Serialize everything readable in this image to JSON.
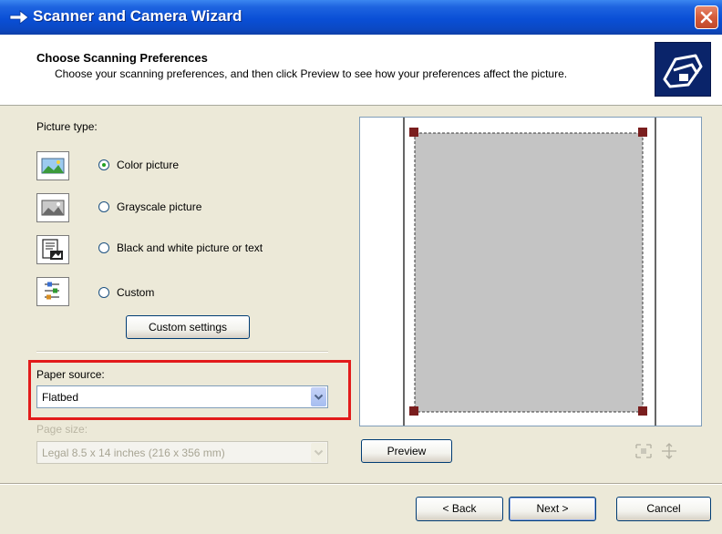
{
  "window": {
    "title": "Scanner and Camera Wizard",
    "close_icon": "close-icon"
  },
  "header": {
    "title": "Choose Scanning Preferences",
    "description": "Choose your scanning preferences, and then click Preview to see how your preferences affect the picture.",
    "icon": "scanner-wizard-icon"
  },
  "picture_type": {
    "label": "Picture type:",
    "options": [
      {
        "label": "Color picture",
        "icon": "color-picture-icon",
        "selected": true
      },
      {
        "label": "Grayscale picture",
        "icon": "grayscale-picture-icon",
        "selected": false
      },
      {
        "label": "Black and white picture or text",
        "icon": "black-white-text-icon",
        "selected": false
      },
      {
        "label": "Custom",
        "icon": "custom-icon",
        "selected": false
      }
    ],
    "custom_settings_label": "Custom settings"
  },
  "paper_source": {
    "label": "Paper source:",
    "value": "Flatbed"
  },
  "page_size": {
    "label": "Page size:",
    "value": "Legal 8.5 x 14 inches (216 x 356 mm)",
    "disabled": true
  },
  "preview": {
    "button_label": "Preview",
    "crop_icon": "crop-fit-icon",
    "zoom_icon": "zoom-icon"
  },
  "footer": {
    "back_label": "< Back",
    "next_label": "Next >",
    "cancel_label": "Cancel"
  },
  "colors": {
    "titlebar": "#0a4fd6",
    "highlight_box": "#e21b1b",
    "radio_selected": "#21a121",
    "preview_scan_area": "#c4c4c4"
  }
}
